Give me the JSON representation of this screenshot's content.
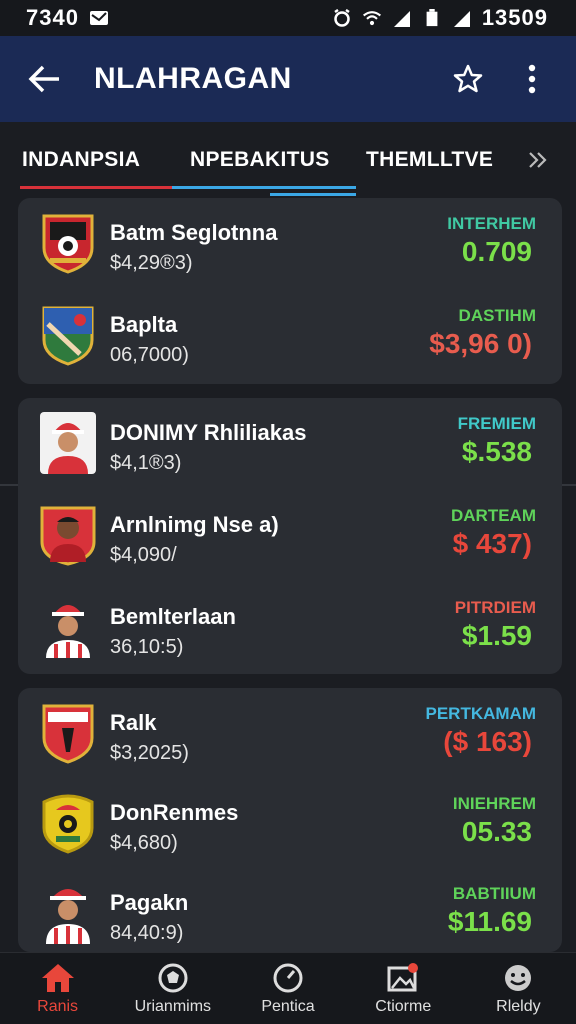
{
  "status": {
    "time": "7340",
    "clock": "13509"
  },
  "app_bar": {
    "title": "NLAHRAGAN"
  },
  "tabs": [
    {
      "label": "INDANPSIA"
    },
    {
      "label": "NPEBAKITUS"
    },
    {
      "label": "THEMLLTVE"
    }
  ],
  "cards": [
    {
      "rows": [
        {
          "name": "Batm Seglotnna",
          "sub": "$4,29®3)",
          "tag": "INTERHEM",
          "tag_color": "#40c9a3",
          "price": "0.709",
          "price_color": "#7be04a",
          "crest": "shield-red-black"
        },
        {
          "name": "Baplta",
          "sub": "06,7000)",
          "tag": "DASTIHM",
          "tag_color": "#5fd35a",
          "price": "$3,96 0)",
          "price_color": "#e85c4e",
          "crest": "shield-blue-green"
        }
      ]
    },
    {
      "rows": [
        {
          "name": "DONIMY Rhliliakas",
          "sub": "$4,1®3)",
          "tag": "FREMIEM",
          "tag_color": "#40c9c9",
          "price": "$.538",
          "price_color": "#7be04a",
          "crest": "player-santa"
        },
        {
          "name": "Arnlnimg Nse a)",
          "sub": "$4,090/",
          "tag": "DARTEAM",
          "tag_color": "#5fd35a",
          "price": "$ 437)",
          "price_color": "#e8473b",
          "crest": "player-red"
        },
        {
          "name": "Bemlterlaan",
          "sub": "36,10:5)",
          "tag": "PITRDIEM",
          "tag_color": "#e85c4e",
          "price": "$1.59",
          "price_color": "#7be04a",
          "crest": "player-santa2"
        }
      ]
    },
    {
      "rows": [
        {
          "name": "Ralk",
          "sub": "$3,2025)",
          "tag": "PERTKAMAM",
          "tag_color": "#44b8e0",
          "price": "($ 163)",
          "price_color": "#e8473b",
          "crest": "shield-red-white"
        },
        {
          "name": "DonRenmes",
          "sub": "$4,680)",
          "tag": "INIEHREM",
          "tag_color": "#5fd35a",
          "price": "05.33",
          "price_color": "#7be04a",
          "crest": "shield-yellow"
        },
        {
          "name": "Pagakn",
          "sub": "84,40:9)",
          "tag": "BABTIIUM",
          "tag_color": "#5fd35a",
          "price": "$11.69",
          "price_color": "#7be04a",
          "crest": "player-santa3"
        }
      ]
    }
  ],
  "bottom_nav": [
    {
      "label": "Ranis",
      "icon": "home-icon"
    },
    {
      "label": "Urianmims",
      "icon": "ball-icon"
    },
    {
      "label": "Pentica",
      "icon": "clock-icon"
    },
    {
      "label": "Ctiorme",
      "icon": "image-icon"
    },
    {
      "label": "Rleldy",
      "icon": "smile-icon"
    }
  ]
}
